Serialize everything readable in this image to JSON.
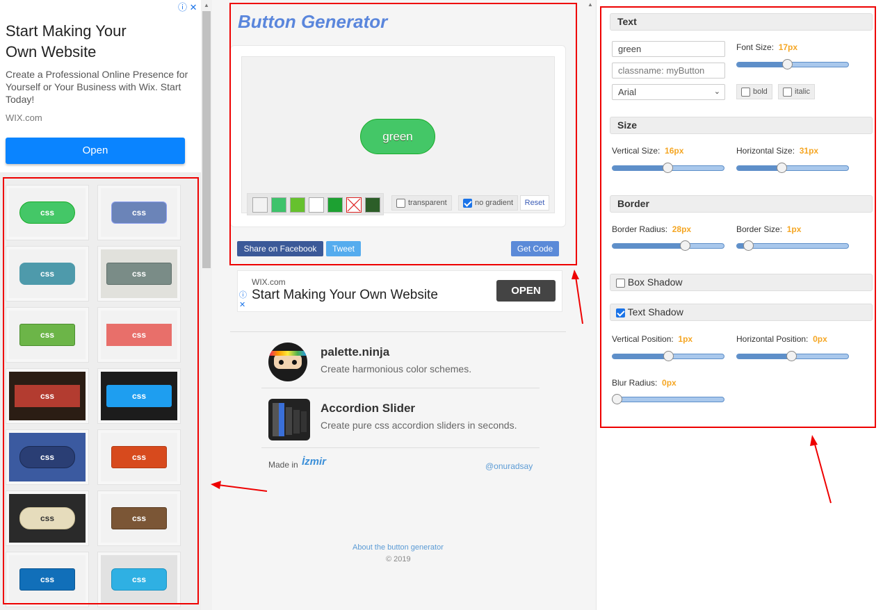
{
  "left_ad": {
    "title": "Start Making Your Own Website",
    "title_line1": "Start Making Your",
    "title_line2": "Own Website",
    "body": "Create a Professional Online Presence for Yourself or Your Business with Wix. Start Today!",
    "source": "WIX.com",
    "open_label": "Open"
  },
  "gallery": {
    "label": "css",
    "items": [
      {
        "bg": "#f2f2f2",
        "btn": "#44c767",
        "text": "#ffffff",
        "radius": "28px",
        "border": "#18ab29"
      },
      {
        "bg": "#f2f2f2",
        "btn": "#6b84b8",
        "text": "#ffffff",
        "radius": "6px",
        "border": "#8b9ef0"
      },
      {
        "bg": "#f2f2f2",
        "btn": "#4e9aab",
        "text": "#ffffff",
        "radius": "8px",
        "border": "#4e9aab"
      },
      {
        "bg": "#e1e1dc",
        "btn": "#7a8c87",
        "text": "#ffffff",
        "radius": "3px",
        "border": "#5f6f6b"
      },
      {
        "bg": "#f2f2f2",
        "btn": "#6cb548",
        "text": "#ffffff",
        "radius": "3px",
        "border": "#4b8e2e"
      },
      {
        "bg": "#f2f2f2",
        "btn": "#e86f6a",
        "text": "#ffffff",
        "radius": "0px",
        "border": "#e86f6a"
      },
      {
        "bg": "#2b1d14",
        "btn": "#b33c30",
        "text": "#ffffff",
        "radius": "0px",
        "border": "#b33c30"
      },
      {
        "bg": "#1c1c1c",
        "btn": "#1e9ef0",
        "text": "#ffffff",
        "radius": "3px",
        "border": "#1e9ef0"
      },
      {
        "bg": "#3b5aa0",
        "btn": "#2a3e74",
        "text": "#ffffff",
        "radius": "15px",
        "border": "#1a2a52"
      },
      {
        "bg": "#f2f2f2",
        "btn": "#d74a1d",
        "text": "#ffffff",
        "radius": "3px",
        "border": "#b43a12"
      },
      {
        "bg": "#2a2a2a",
        "btn": "#e6dcbc",
        "text": "#333333",
        "radius": "15px",
        "border": "#c9bd94"
      },
      {
        "bg": "#f2f2f2",
        "btn": "#7b5636",
        "text": "#ffffff",
        "radius": "3px",
        "border": "#5a3c22"
      },
      {
        "bg": "#f2f2f2",
        "btn": "#116fb9",
        "text": "#ffffff",
        "radius": "3px",
        "border": "#0b5591"
      },
      {
        "bg": "#e2e2e2",
        "btn": "#2fb0e3",
        "text": "#ffffff",
        "radius": "6px",
        "border": "#1c94c4"
      }
    ]
  },
  "header": {
    "title": "Button Generator"
  },
  "preview": {
    "label": "green",
    "swatches": [
      "#f2f2f2",
      "#3ec36b",
      "#66c12e",
      "#ffffff",
      "#1da132",
      "none",
      "#2c5e28"
    ],
    "transparent_label": "transparent",
    "transparent_checked": false,
    "no_gradient_label": "no gradient",
    "no_gradient_checked": true,
    "reset_label": "Reset"
  },
  "actions": {
    "facebook_label": "Share on Facebook",
    "tweet_label": "Tweet",
    "getcode_label": "Get Code"
  },
  "center_ad": {
    "source": "WIX.com",
    "title": "Start Making Your Own Website",
    "open_label": "OPEN"
  },
  "promos": [
    {
      "title": "palette.ninja",
      "desc": "Create harmonious color schemes."
    },
    {
      "title": "Accordion Slider",
      "desc": "Create pure css accordion sliders in seconds."
    }
  ],
  "footer": {
    "made_in": "Made in",
    "author": "@onuradsay",
    "about": "About the button generator",
    "copyright": "© 2019",
    "brand": "İzmir"
  },
  "panel": {
    "text": {
      "header": "Text",
      "text_value": "green",
      "classname_placeholder": "classname: myButton",
      "font_value": "Arial",
      "font_size_label": "Font Size:",
      "font_size_value": "17px",
      "font_size_fraction": 0.45,
      "bold_label": "bold",
      "italic_label": "italic"
    },
    "size": {
      "header": "Size",
      "vertical_label": "Vertical Size:",
      "vertical_value": "16px",
      "vertical_fraction": 0.5,
      "horizontal_label": "Horizontal Size:",
      "horizontal_value": "31px",
      "horizontal_fraction": 0.4
    },
    "border": {
      "header": "Border",
      "radius_label": "Border Radius:",
      "radius_value": "28px",
      "radius_fraction": 0.67,
      "size_label": "Border Size:",
      "size_value": "1px",
      "size_fraction": 0.07
    },
    "box_shadow": {
      "header": "Box Shadow",
      "checked": false
    },
    "text_shadow": {
      "header": "Text Shadow",
      "checked": true,
      "vpos_label": "Vertical Position:",
      "vpos_value": "1px",
      "vpos_fraction": 0.51,
      "hpos_label": "Horizontal Position:",
      "hpos_value": "0px",
      "hpos_fraction": 0.49,
      "blur_label": "Blur Radius:",
      "blur_value": "0px",
      "blur_fraction": 0.0
    }
  }
}
